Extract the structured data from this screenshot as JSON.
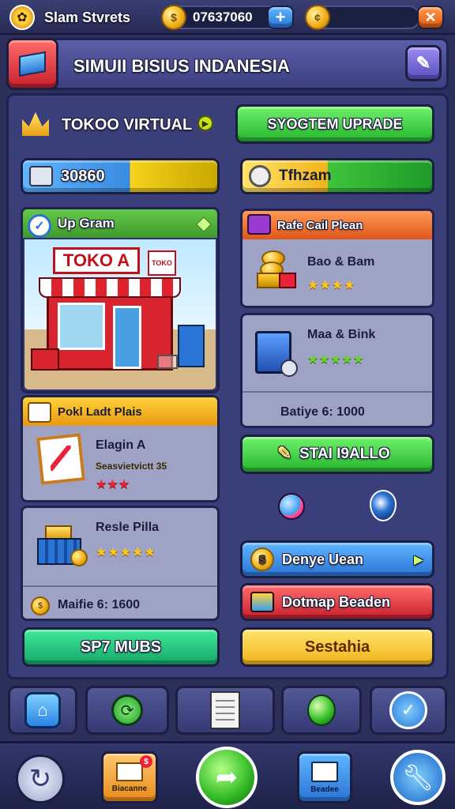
{
  "topbar": {
    "player_name": "Slam Stvrets",
    "currency": "07637060",
    "plus": "+",
    "close": "✕"
  },
  "header": {
    "title": "SIMUII BISIUS INDANESIA"
  },
  "row1": {
    "left_label": "TOKOO VIRTUAL",
    "right_button": "SYOGTEM UPRADE"
  },
  "row2": {
    "left_value": "30860",
    "right_value": "Tfhzam"
  },
  "store_card": {
    "title": "Up Gram",
    "sign": "TOKO A",
    "sign_side": "TOKO"
  },
  "plan_card": {
    "title": "Rafe Cail Plean",
    "item1": {
      "name": "Bao & Bam",
      "stars": "★★★★"
    },
    "item2": {
      "name": "Maa & Bink",
      "stars": "★★★★★"
    },
    "footer": "Batiye 6: 1000"
  },
  "right_start_button": "STAI I9ALLO",
  "left_panel": {
    "title": "Pokl Ladt Plais",
    "item1": {
      "name": "Elagin A",
      "sub": "Seasvietvictt 35",
      "stars": "★★★"
    },
    "item2": {
      "name": "Resle Pilla",
      "stars": "★★★★★"
    },
    "footer": "Maifie 6: 1600"
  },
  "left_bottom_button": "SP7 MUBS",
  "right_panels": {
    "blue_button": "Denye Uean",
    "red_button": "Dotmap Beaden",
    "yellow_button": "Sestahia"
  },
  "dock": {
    "mail_label": "Biacanne",
    "book_label": "Beadee",
    "mail_badge": "$"
  },
  "colors": {
    "accent_green": "#27b52f",
    "accent_yellow": "#f0b41b",
    "accent_blue": "#2a74d6",
    "accent_red": "#c8202c",
    "panel": "#3a3f7a"
  },
  "icons": [
    "bee-avatar-icon",
    "coin-icon",
    "plus-icon",
    "close-icon",
    "crate-icon",
    "pencil-icon",
    "crown-icon",
    "play-arrow-icon",
    "machine-icon",
    "clock-icon",
    "check-badge-icon",
    "gem-icon",
    "coin-stack-icon",
    "safe-icon",
    "frame-icon",
    "basket-icon",
    "paint-icon",
    "balloon-icon",
    "globe-icon",
    "gold-coin-icon",
    "chest-icon",
    "home-icon",
    "sync-icon",
    "document-icon",
    "green-balloon-icon",
    "refresh-icon",
    "mail-icon",
    "share-icon",
    "book-icon",
    "wrench-icon"
  ]
}
